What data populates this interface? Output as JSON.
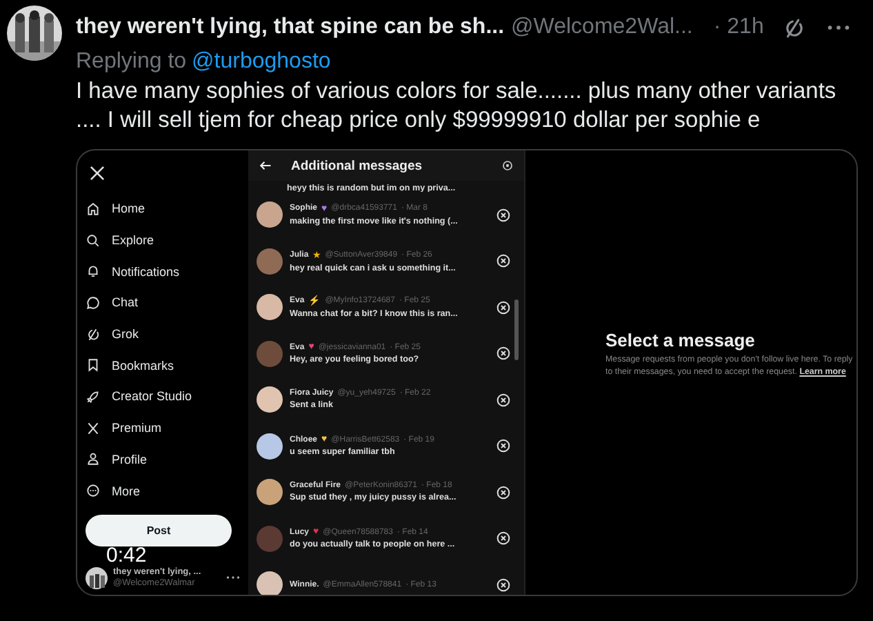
{
  "post": {
    "author": "they weren't lying, that spine can be sh...",
    "handle": "@Welcome2Wal...",
    "time": "· 21h",
    "replying_label": "Replying to",
    "replying_to": "@turboghosto",
    "text": "I have many sophies of various colors for sale....... plus many other variants .... I will sell tjem for cheap price only $99999910 dollar per sophie e"
  },
  "video": {
    "timestamp": "0:42",
    "sidebar": {
      "items": [
        {
          "label": "Home"
        },
        {
          "label": "Explore"
        },
        {
          "label": "Notifications"
        },
        {
          "label": "Chat"
        },
        {
          "label": "Grok"
        },
        {
          "label": "Bookmarks"
        },
        {
          "label": "Creator Studio"
        },
        {
          "label": "Premium"
        },
        {
          "label": "Profile"
        },
        {
          "label": "More"
        }
      ],
      "post_button": "Post",
      "account": {
        "name": "they weren't lying, ...",
        "handle": "@Welcome2Walmar"
      }
    },
    "messages": {
      "title": "Additional messages",
      "partial_preview": "heyy this is random but im on my priva...",
      "items": [
        {
          "name": "Sophie",
          "badge": "♥",
          "color": "#a77de8",
          "handle": "@drbca41593771",
          "date": "· Mar 8",
          "preview": "making the first move like it's nothing (..."
        },
        {
          "name": "Julia",
          "badge": "★",
          "color": "#f4b400",
          "handle": "@SuttonAver39849",
          "date": "· Feb 26",
          "preview": "hey real quick can i ask u something it..."
        },
        {
          "name": "Eva",
          "badge": "⚡",
          "color": "#f7c325",
          "handle": "@MyInfo13724687",
          "date": "· Feb 25",
          "preview": "Wanna chat for a bit? I know this is ran..."
        },
        {
          "name": "Eva",
          "badge": "♥",
          "color": "#e8457a",
          "handle": "@jessicavianna01",
          "date": "· Feb 25",
          "preview": "Hey, are you feeling bored too?"
        },
        {
          "name": "Fiora Juicy",
          "handle": "@yu_yeh49725",
          "date": "· Feb 22",
          "preview": "Sent a link"
        },
        {
          "name": "Chloee",
          "badge": "♥",
          "color": "#f5c242",
          "handle": "@HarrisBett62583",
          "date": "· Feb 19",
          "preview": "u seem super familiar tbh"
        },
        {
          "name": "Graceful Fire",
          "handle": "@PeterKonin86371",
          "date": "· Feb 18",
          "preview": "Sup stud they , my juicy pussy is alrea..."
        },
        {
          "name": "Lucy",
          "badge": "♥",
          "color": "#e0314b",
          "handle": "@Queen78588783",
          "date": "· Feb 14",
          "preview": "do you actually talk to people on here ..."
        },
        {
          "name": "Winnie.",
          "handle": "@EmmaAllen578841",
          "date": "· Feb 13"
        }
      ]
    },
    "detail": {
      "title": "Select a message",
      "text": "Message requests from people you don't follow live here. To reply to their messages, you need to accept the request.",
      "link": "Learn more"
    }
  }
}
